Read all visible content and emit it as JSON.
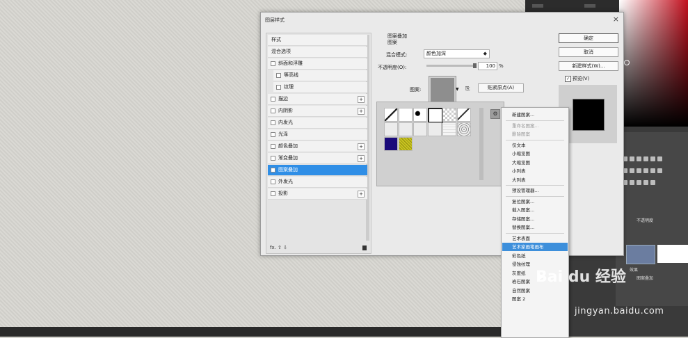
{
  "dialog": {
    "title": "图层样式",
    "close_glyph": "×"
  },
  "style_list": {
    "items": [
      {
        "label": "样式",
        "checkbox": false,
        "plus": false,
        "active": false,
        "indent": false
      },
      {
        "label": "混合选项",
        "checkbox": false,
        "plus": false,
        "active": false,
        "indent": false
      },
      {
        "label": "斜面和浮雕",
        "checkbox": true,
        "plus": false,
        "active": false,
        "indent": false
      },
      {
        "label": "等高线",
        "checkbox": true,
        "plus": false,
        "active": false,
        "indent": true
      },
      {
        "label": "纹理",
        "checkbox": true,
        "plus": false,
        "active": false,
        "indent": true
      },
      {
        "label": "描边",
        "checkbox": true,
        "plus": true,
        "active": false,
        "indent": false
      },
      {
        "label": "内阴影",
        "checkbox": true,
        "plus": true,
        "active": false,
        "indent": false
      },
      {
        "label": "内发光",
        "checkbox": true,
        "plus": false,
        "active": false,
        "indent": false
      },
      {
        "label": "光泽",
        "checkbox": true,
        "plus": false,
        "active": false,
        "indent": false
      },
      {
        "label": "颜色叠加",
        "checkbox": true,
        "plus": true,
        "active": false,
        "indent": false
      },
      {
        "label": "渐变叠加",
        "checkbox": true,
        "plus": true,
        "active": false,
        "indent": false
      },
      {
        "label": "图案叠加",
        "checkbox": true,
        "plus": false,
        "active": true,
        "indent": false
      },
      {
        "label": "外发光",
        "checkbox": true,
        "plus": false,
        "active": false,
        "indent": false
      },
      {
        "label": "投影",
        "checkbox": true,
        "plus": true,
        "active": false,
        "indent": false
      }
    ],
    "plus_glyph": "+",
    "footer": "fx. ⇧ ⇩"
  },
  "settings": {
    "group_title": "图案叠加",
    "group_sub": "图案",
    "blend_label": "混合模式:",
    "blend_value": "颜色加深",
    "opacity_label": "不透明度(O):",
    "opacity_value": "100",
    "opacity_unit": "%",
    "opacity_fraction": 1.0,
    "pattern_label": "图案:",
    "snap_button": "贴紧原点(A)"
  },
  "buttons": {
    "ok": "确定",
    "cancel": "取消",
    "new_style": "新建样式(W)...",
    "preview": "预览(V)",
    "preview_checked": "✓"
  },
  "pattern_picker": {
    "gear_glyph": "⚙",
    "patterns": [
      {
        "kind": "diagonal"
      },
      {
        "kind": "dots-white"
      },
      {
        "kind": "black-square"
      },
      {
        "kind": "white-box"
      },
      {
        "kind": "checker"
      },
      {
        "kind": "pen"
      },
      {
        "kind": "light"
      },
      {
        "kind": "light"
      },
      {
        "kind": "light"
      },
      {
        "kind": "light"
      },
      {
        "kind": "grid"
      },
      {
        "kind": "noise"
      },
      {
        "kind": "navy",
        "color": "#1a0a7a"
      },
      {
        "kind": "yellow",
        "color": "#c9c420"
      }
    ]
  },
  "menu": {
    "items": [
      {
        "label": "新建图案...",
        "disabled": false,
        "hl": false
      },
      {
        "sep": true
      },
      {
        "label": "重命名图案...",
        "disabled": true,
        "hl": false
      },
      {
        "label": "删除图案",
        "disabled": true,
        "hl": false
      },
      {
        "sep": true
      },
      {
        "label": "仅文本",
        "disabled": false,
        "hl": false
      },
      {
        "label": "小缩览图",
        "disabled": false,
        "hl": false
      },
      {
        "label": "大缩览图",
        "disabled": false,
        "hl": false
      },
      {
        "label": "小列表",
        "disabled": false,
        "hl": false
      },
      {
        "label": "大列表",
        "disabled": false,
        "hl": false
      },
      {
        "sep": true
      },
      {
        "label": "预设管理器...",
        "disabled": false,
        "hl": false
      },
      {
        "sep": true
      },
      {
        "label": "复位图案...",
        "disabled": false,
        "hl": false
      },
      {
        "label": "载入图案...",
        "disabled": false,
        "hl": false
      },
      {
        "label": "存储图案...",
        "disabled": false,
        "hl": false
      },
      {
        "label": "替换图案...",
        "disabled": false,
        "hl": false
      },
      {
        "sep": true
      },
      {
        "label": "艺术表面",
        "disabled": false,
        "hl": false
      },
      {
        "label": "艺术家画笔画布",
        "disabled": false,
        "hl": true
      },
      {
        "label": "彩色纸",
        "disabled": false,
        "hl": false
      },
      {
        "label": "侵蚀纹理",
        "disabled": false,
        "hl": false
      },
      {
        "label": "灰度纸",
        "disabled": false,
        "hl": false
      },
      {
        "label": "岩石图案",
        "disabled": false,
        "hl": false
      },
      {
        "label": "自然图案",
        "disabled": false,
        "hl": false
      },
      {
        "label": "图案 2",
        "disabled": false,
        "hl": false
      }
    ]
  },
  "ps_layers": {
    "effects_label": "效果",
    "pattern_overlay_label": "图案叠加",
    "opacity_short": "不透明度"
  },
  "watermark": {
    "brand": "Bai du 经验",
    "url": "jingyan.baidu.com"
  },
  "colors": {
    "accent": "#2f8ee6",
    "menu_highlight": "#3d8fdb",
    "picker_red": "#c2101e"
  }
}
